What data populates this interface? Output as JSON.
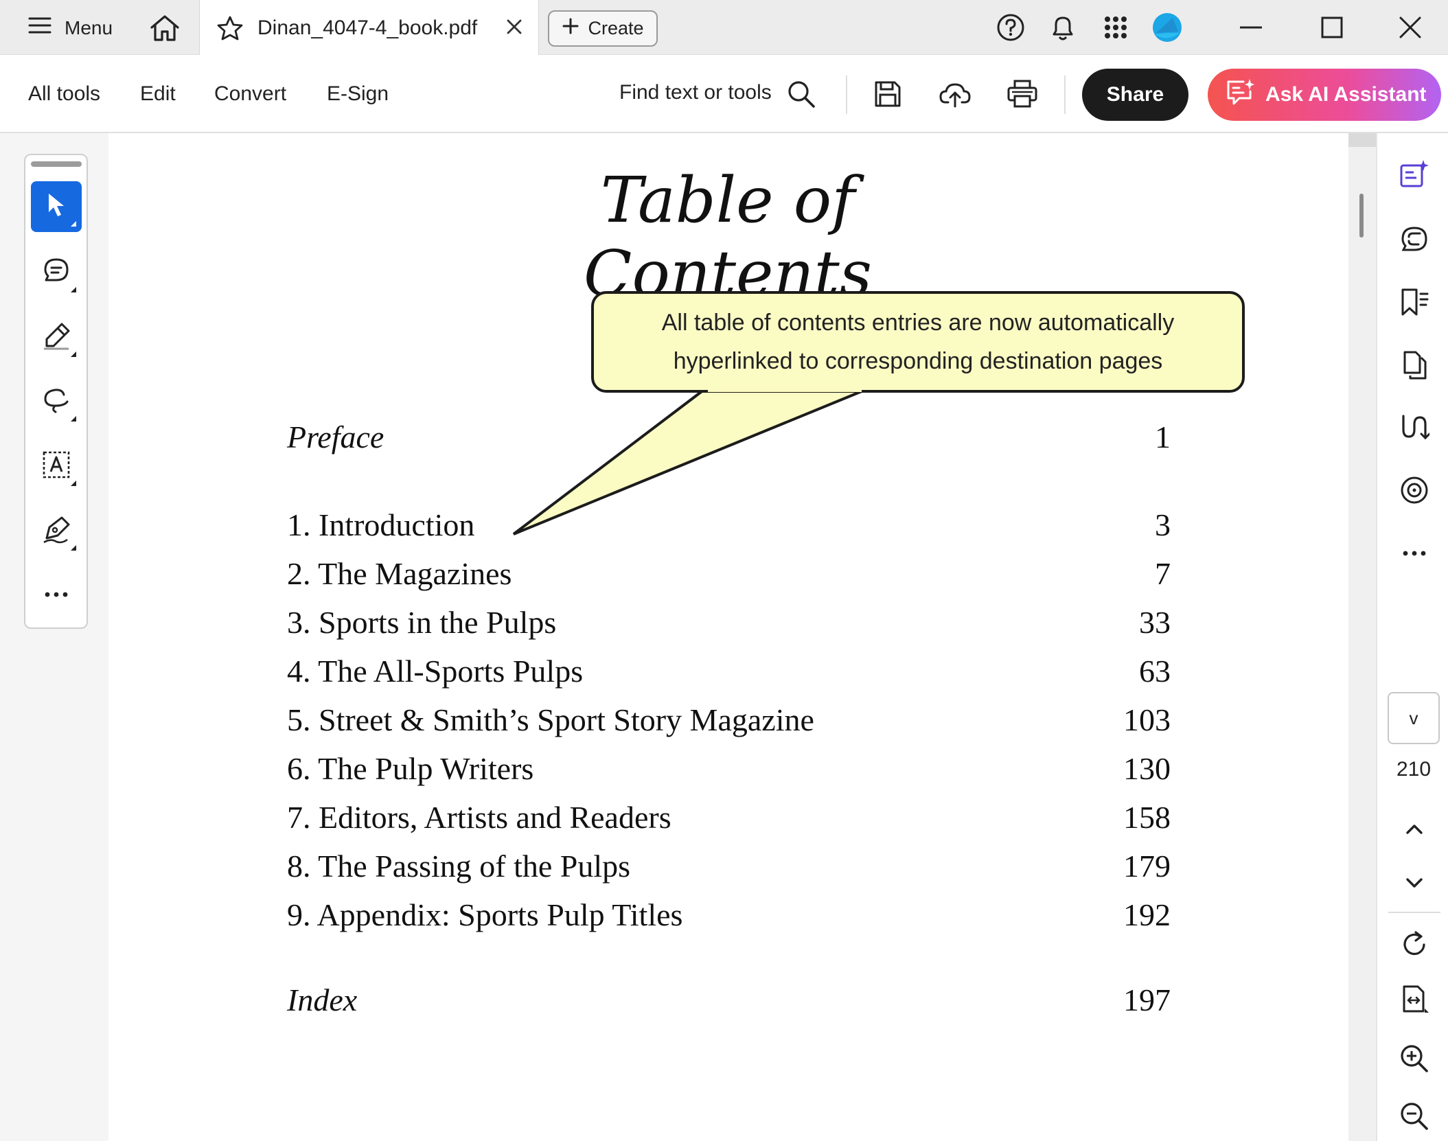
{
  "titlebar": {
    "menu_label": "Menu",
    "tab_title": "Dinan_4047-4_book.pdf",
    "create_label": "Create"
  },
  "toolbar": {
    "all_tools": "All tools",
    "edit": "Edit",
    "convert": "Convert",
    "esign": "E-Sign",
    "find": "Find text or tools",
    "share": "Share",
    "ai": "Ask AI Assistant"
  },
  "document": {
    "title": "Table of Contents",
    "entries": [
      {
        "label": "Preface",
        "page": "1",
        "italic": true
      },
      {
        "label": "1.  Introduction",
        "page": "3"
      },
      {
        "label": "2.  The Magazines",
        "page": "7"
      },
      {
        "label": "3.  Sports in the Pulps",
        "page": "33"
      },
      {
        "label": "4.  The All-Sports Pulps",
        "page": "63"
      },
      {
        "label": "5.  Street & Smith’s Sport Story Magazine",
        "page": "103"
      },
      {
        "label": "6.  The Pulp Writers",
        "page": "130"
      },
      {
        "label": "7.  Editors, Artists and Readers",
        "page": "158"
      },
      {
        "label": "8.  The Passing of the Pulps",
        "page": "179"
      },
      {
        "label": "9.  Appendix: Sports Pulp Titles",
        "page": "192"
      },
      {
        "label": "Index",
        "page": "197",
        "italic": true
      }
    ]
  },
  "callout": {
    "line1": "All table of contents entries are now automatically",
    "line2": "hyperlinked to corresponding destination pages"
  },
  "pager": {
    "current": "v",
    "total": "210"
  },
  "colors": {
    "accent": "#1769e0",
    "callout_fill": "#fbfbc4",
    "share_bg": "#1c1c1c",
    "ai_gradient_start": "#f4544f",
    "ai_gradient_end": "#b363f2"
  }
}
